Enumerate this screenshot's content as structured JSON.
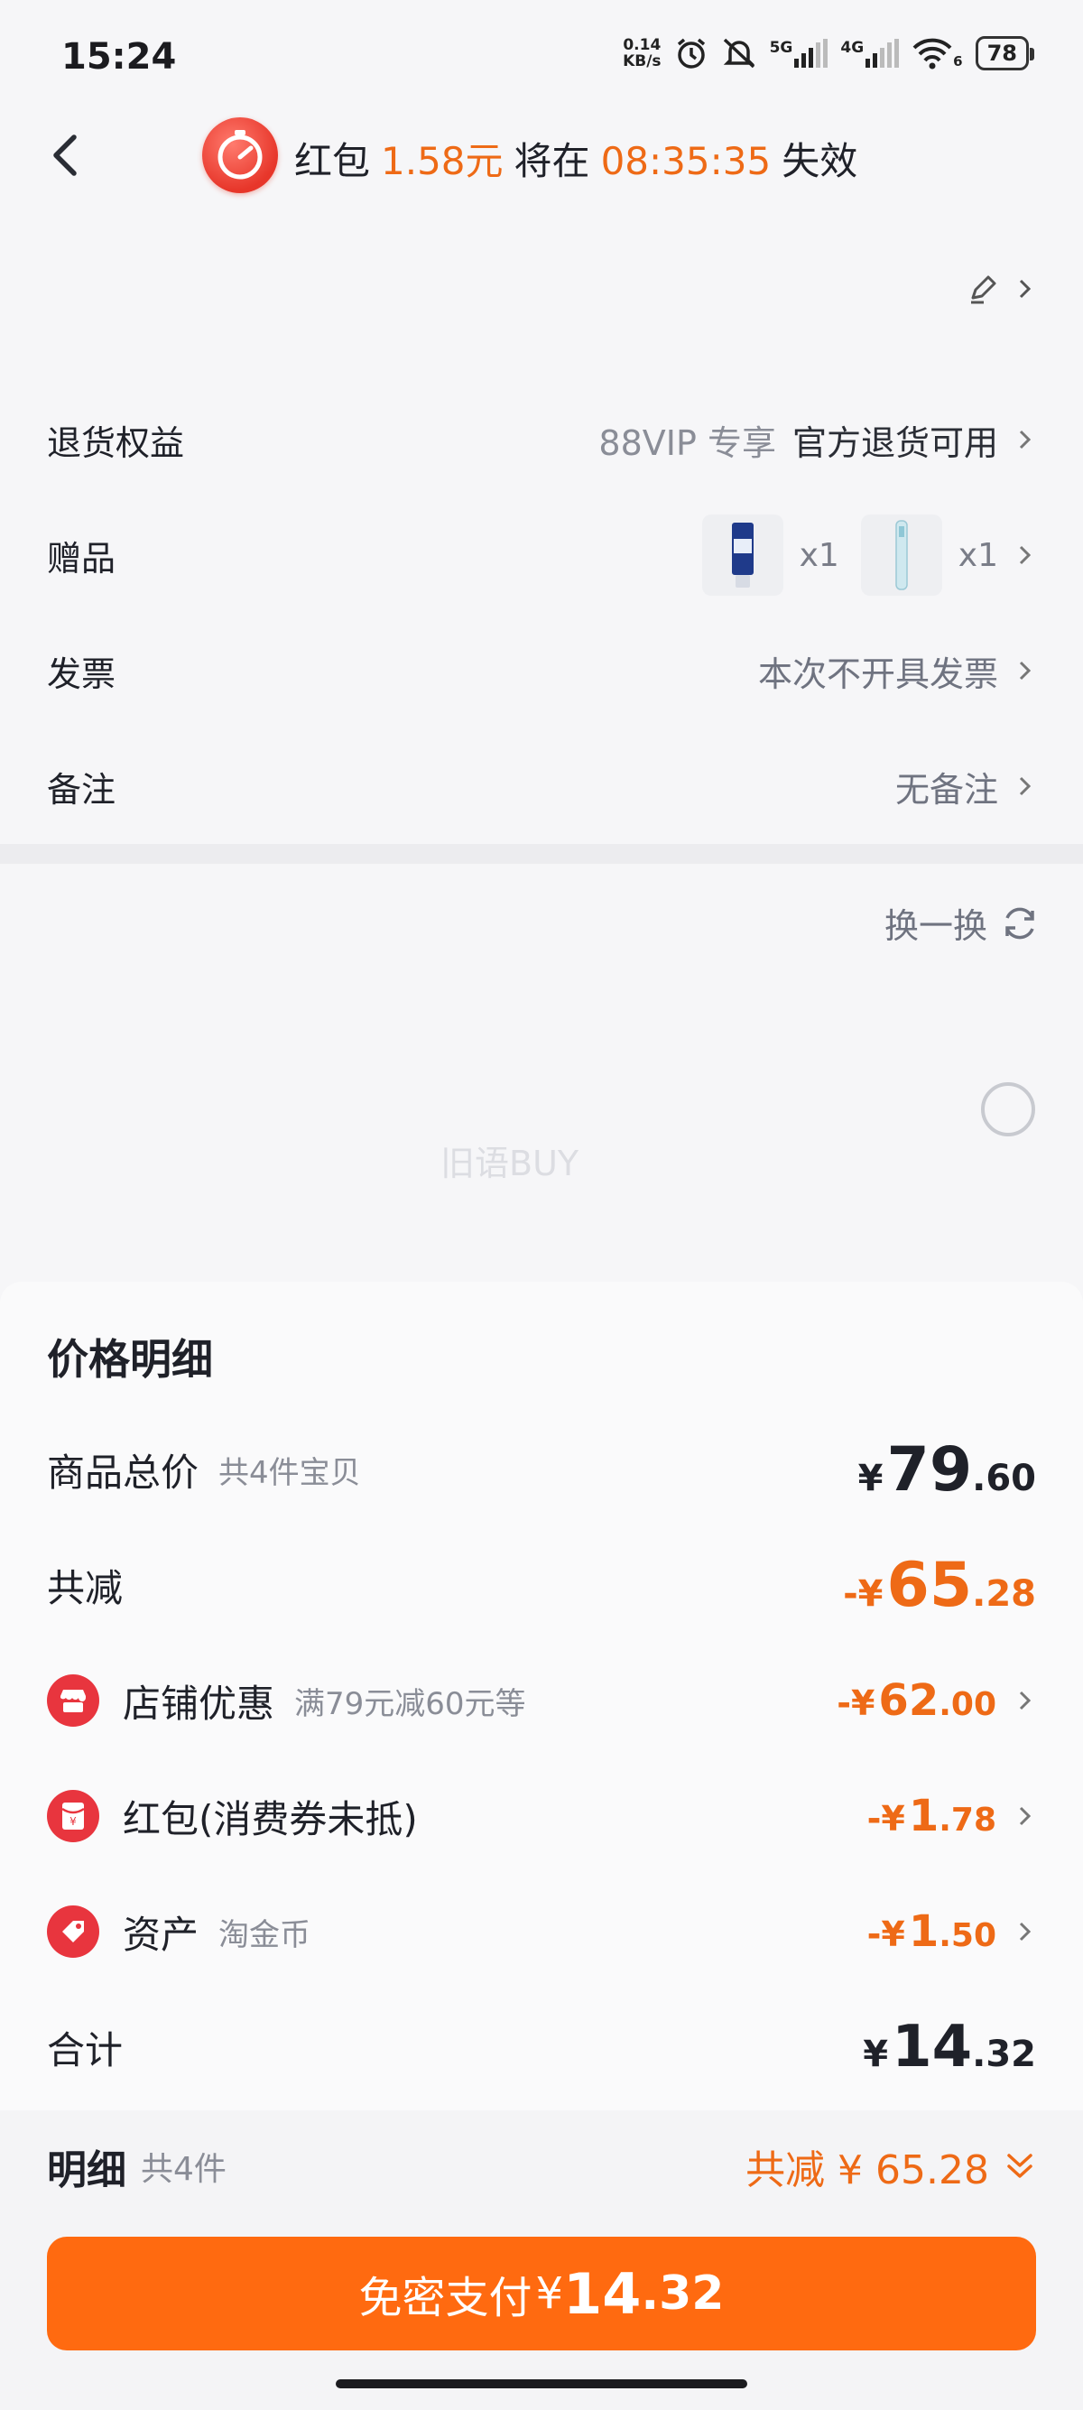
{
  "status": {
    "time": "15:24",
    "net_speed_top": "0.14",
    "net_speed_bottom": "KB/s",
    "sig1_label": "5G",
    "sig2_label": "4G",
    "wifi_sub": "6",
    "battery": "78"
  },
  "header": {
    "prefix": "红包",
    "amount": "1.58元",
    "middle": "将在",
    "countdown": "08:35:35",
    "suffix": "失效"
  },
  "rows": [
    {
      "label": "退货权益",
      "tag": "88VIP 专享",
      "value": "官方退货可用"
    },
    {
      "label": "赠品",
      "gift1_qty": "x1",
      "gift2_qty": "x1"
    },
    {
      "label": "发票",
      "value": "本次不开具发票"
    },
    {
      "label": "备注",
      "value": "无备注"
    }
  ],
  "swap_label": "换一换",
  "watermark": "旧语BUY",
  "price": {
    "title": "价格明细",
    "total": {
      "label": "商品总价",
      "sub": "共4件宝贝",
      "cur": "¥",
      "int": "79",
      "dec": ".60"
    },
    "reduce": {
      "label": "共减",
      "cur": "-¥",
      "int": "65",
      "dec": ".28"
    },
    "shop": {
      "label": "店铺优惠",
      "sub": "满79元减60元等",
      "cur": "-¥",
      "int": "62",
      "dec": ".00"
    },
    "redpack": {
      "label": "红包(消费券未抵)",
      "cur": "-¥",
      "int": "1",
      "dec": ".78"
    },
    "asset": {
      "label": "资产",
      "sub": "淘金币",
      "cur": "-¥",
      "int": "1",
      "dec": ".50"
    },
    "sum": {
      "label": "合计",
      "cur": "¥",
      "int": "14",
      "dec": ".32"
    }
  },
  "bottom": {
    "detail_label": "明细",
    "detail_sub": "共4件",
    "reduce_text": "共减 ¥ 65.28",
    "pay_label": "免密支付",
    "pay_cur": "¥",
    "pay_int": "14",
    "pay_dec": ".32"
  },
  "colors": {
    "accent": "#ee6a16",
    "pay_button": "#ff6a10",
    "icon_red": "#e8353e"
  }
}
